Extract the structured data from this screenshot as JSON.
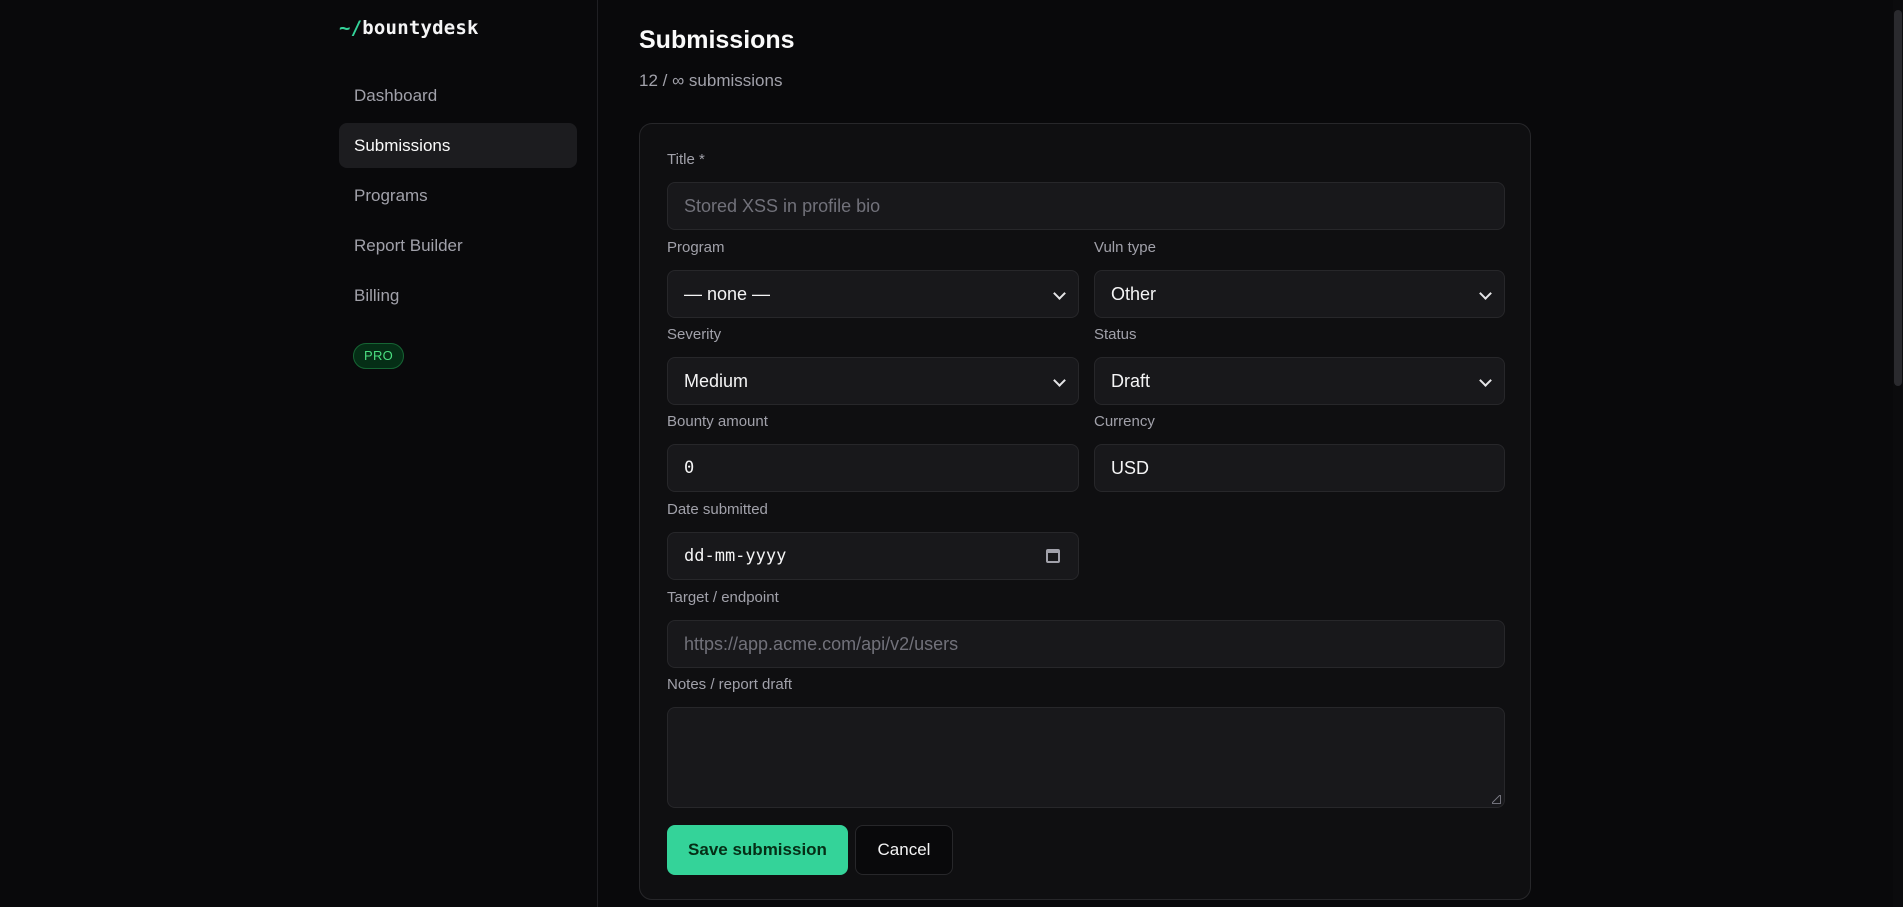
{
  "brand": {
    "prefix": "~/",
    "name": "bountydesk"
  },
  "nav": {
    "items": [
      {
        "label": "Dashboard"
      },
      {
        "label": "Submissions"
      },
      {
        "label": "Programs"
      },
      {
        "label": "Report Builder"
      },
      {
        "label": "Billing"
      }
    ],
    "active": "Submissions",
    "badge": "PRO"
  },
  "page": {
    "title": "Submissions",
    "subtitle": "12 / ∞ submissions"
  },
  "form": {
    "title": {
      "label": "Title *",
      "placeholder": "Stored XSS in profile bio"
    },
    "program": {
      "label": "Program",
      "value": "— none —"
    },
    "vuln_type": {
      "label": "Vuln type",
      "value": "Other"
    },
    "severity": {
      "label": "Severity",
      "value": "Medium"
    },
    "status": {
      "label": "Status",
      "value": "Draft"
    },
    "bounty_amount": {
      "label": "Bounty amount",
      "value": "0"
    },
    "currency": {
      "label": "Currency",
      "value": "USD"
    },
    "date_submitted": {
      "label": "Date submitted",
      "placeholder": "dd-mm-yyyy"
    },
    "target": {
      "label": "Target / endpoint",
      "placeholder": "https://app.acme.com/api/v2/users"
    },
    "notes": {
      "label": "Notes / report draft",
      "value": ""
    },
    "save_label": "Save submission",
    "cancel_label": "Cancel"
  },
  "colors": {
    "accent": "#34d399",
    "background": "#09090b",
    "card": "#0f0f11",
    "input": "#18181b"
  }
}
